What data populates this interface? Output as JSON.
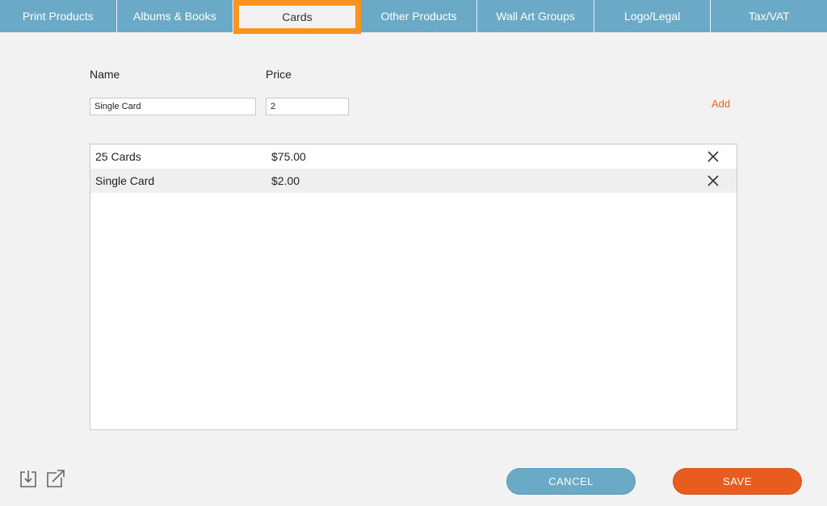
{
  "tabs": [
    {
      "label": "Print Products"
    },
    {
      "label": "Albums & Books"
    },
    {
      "label": "Cards",
      "active": true
    },
    {
      "label": "Other Products"
    },
    {
      "label": "Wall Art Groups"
    },
    {
      "label": "Logo/Legal"
    },
    {
      "label": "Tax/VAT"
    }
  ],
  "form": {
    "name_label": "Name",
    "price_label": "Price",
    "name_value": "Single Card",
    "price_value": "2",
    "add_label": "Add"
  },
  "items": [
    {
      "name": "25 Cards",
      "price": "$75.00"
    },
    {
      "name": "Single Card",
      "price": "$2.00"
    }
  ],
  "footer": {
    "import_icon": "import-icon",
    "export_icon": "export-icon",
    "cancel_label": "CANCEL",
    "save_label": "SAVE"
  },
  "colors": {
    "tab_bar": "#6aaac6",
    "active_tab_highlight": "#f7931e",
    "accent": "#e85d1f",
    "cancel_button": "#6aaac6"
  }
}
